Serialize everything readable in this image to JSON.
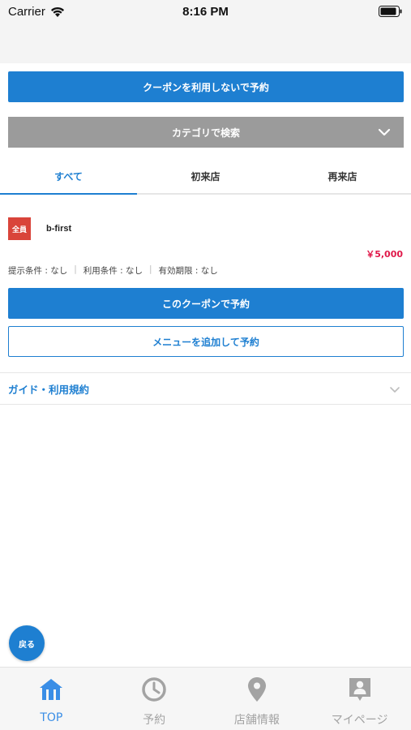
{
  "status_bar": {
    "carrier": "Carrier",
    "time": "8:16 PM"
  },
  "actions": {
    "no_coupon_label": "クーポンを利用しないで予約",
    "category_search_label": "カテゴリで検索"
  },
  "tabs": [
    {
      "label": "すべて",
      "active": true
    },
    {
      "label": "初来店",
      "active": false
    },
    {
      "label": "再来店",
      "active": false
    }
  ],
  "coupon": {
    "badge": "全員",
    "name": "b-first",
    "price": "￥5,000",
    "conditions": {
      "offer": "提示条件 : なし",
      "usage": "利用条件 : なし",
      "expiry": "有効期限 : なし",
      "separator": "|"
    },
    "use_label": "このクーポンで予約",
    "add_menu_label": "メニューを追加して予約"
  },
  "guide": {
    "label": "ガイド・利用規約"
  },
  "back_button": {
    "label": "戻る"
  },
  "tabbar": [
    {
      "label": "TOP",
      "icon": "home-icon",
      "active": true
    },
    {
      "label": "予約",
      "icon": "clock-icon",
      "active": false
    },
    {
      "label": "店舗情報",
      "icon": "location-pin-icon",
      "active": false
    },
    {
      "label": "マイページ",
      "icon": "user-icon",
      "active": false
    }
  ],
  "colors": {
    "primary": "#1e7fd1",
    "category_bar": "#9b9b9b",
    "badge": "#d9443a",
    "price": "#e0194a",
    "tab_active": "#3a8ee6",
    "tab_inactive": "#a3a3a3"
  }
}
